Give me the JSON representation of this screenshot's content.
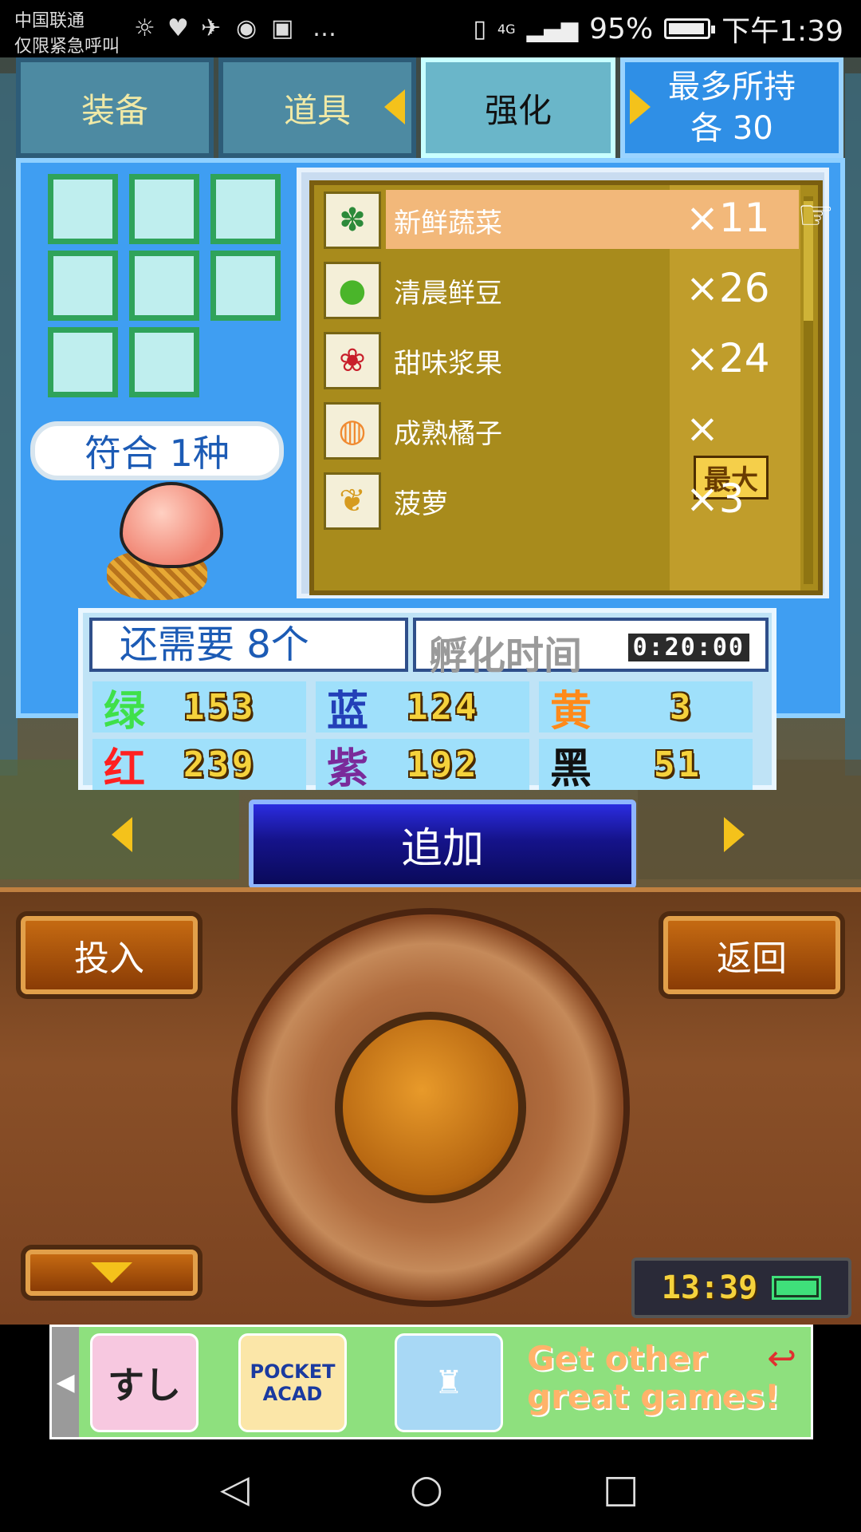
{
  "status_bar": {
    "carrier_line1": "中国联通",
    "carrier_line2": "仅限紧急呼叫",
    "network": "4G",
    "battery": "95%",
    "time": "下午1:39"
  },
  "tabs": {
    "equip": "装备",
    "item": "道具",
    "enhance": "强化",
    "max_line1": "最多所持",
    "max_line2": "各 30"
  },
  "match_label": "符合 1种",
  "items": [
    {
      "name": "新鲜蔬菜",
      "count": "×11",
      "icon": "vegetable-icon"
    },
    {
      "name": "清晨鲜豆",
      "count": "×26",
      "icon": "bean-icon"
    },
    {
      "name": "甜味浆果",
      "count": "×24",
      "icon": "berry-icon"
    },
    {
      "name": "成熟橘子",
      "count": "×",
      "badge": "最大",
      "icon": "orange-icon"
    },
    {
      "name": "菠萝",
      "count": "×3",
      "icon": "pineapple-icon"
    }
  ],
  "hatch": {
    "need": "还需要 8个",
    "time_label": "孵化时间",
    "time_value": "0:20:00"
  },
  "colors": [
    {
      "label": "绿",
      "value": "153",
      "color": "#3fe04a"
    },
    {
      "label": "蓝",
      "value": "124",
      "color": "#2340b8"
    },
    {
      "label": "黄",
      "value": "3",
      "color": "#ff8a1a"
    },
    {
      "label": "红",
      "value": "239",
      "color": "#ff2020"
    },
    {
      "label": "紫",
      "value": "192",
      "color": "#7a2a9a"
    },
    {
      "label": "黑",
      "value": "51",
      "color": "#111111"
    }
  ],
  "buttons": {
    "add": "追加",
    "put_in": "投入",
    "back": "返回"
  },
  "clock": "13:39",
  "ad": {
    "thumb1": "すし",
    "thumb2": "POCKET ACAD",
    "thumb3": "",
    "text": "Get other great games!"
  }
}
